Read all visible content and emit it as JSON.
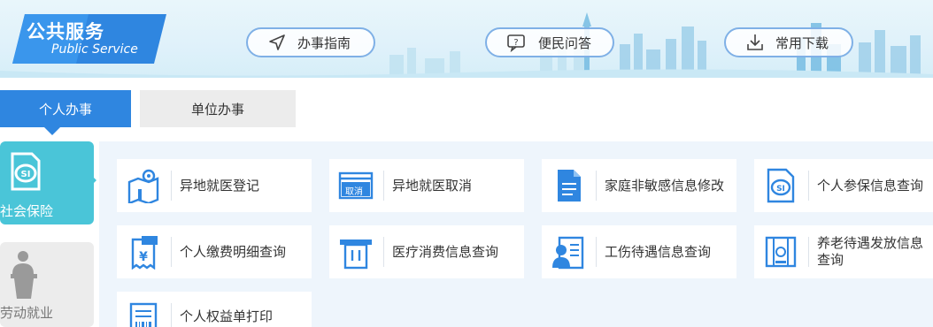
{
  "banner": {
    "brand_cn": "公共服务",
    "brand_en": "Public Service",
    "colors": {
      "brand": "#2f86e0",
      "sky": "#dff1fa",
      "pill_border": "#7fb0e6"
    },
    "links": [
      {
        "label": "办事指南",
        "icon": "send-arrow-icon"
      },
      {
        "label": "便民问答",
        "icon": "question-chat-icon"
      },
      {
        "label": "常用下载",
        "icon": "download-tray-icon"
      }
    ]
  },
  "tabs": [
    {
      "label": "个人办事",
      "active": true
    },
    {
      "label": "单位办事",
      "active": false
    }
  ],
  "categories": [
    {
      "label": "社会保险",
      "icon": "social-insurance-si-icon",
      "active": true,
      "color": "#4ac5d8"
    },
    {
      "label": "劳动就业",
      "icon": "person-podium-icon",
      "active": false,
      "color": "#ececec"
    }
  ],
  "services": [
    {
      "label": "异地就医登记",
      "icon": "map-pin-location-icon"
    },
    {
      "label": "异地就医取消",
      "icon": "cancel-window-icon",
      "icon_text": "取消"
    },
    {
      "label": "家庭非敏感信息修改",
      "icon": "document-edit-icon"
    },
    {
      "label": "个人参保信息查询",
      "icon": "si-document-icon"
    },
    {
      "label": "个人缴费明细查询",
      "icon": "yen-receipt-icon"
    },
    {
      "label": "医疗消费信息查询",
      "icon": "medical-receipt-icon"
    },
    {
      "label": "工伤待遇信息查询",
      "icon": "worker-id-card-icon"
    },
    {
      "label": "养老待遇发放信息查询",
      "icon": "pension-certificate-icon"
    },
    {
      "label": "个人权益单打印",
      "icon": "barcode-document-icon"
    }
  ]
}
